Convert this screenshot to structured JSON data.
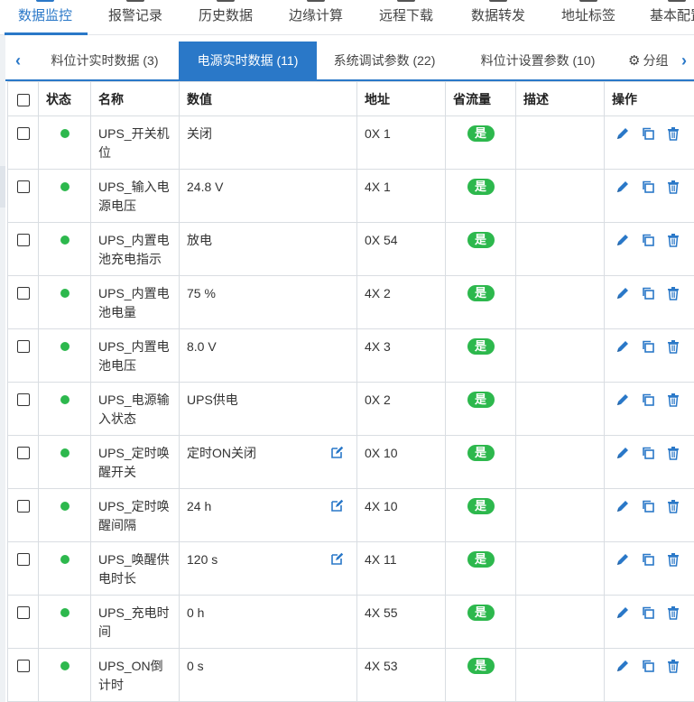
{
  "nav": {
    "items": [
      "数据监控",
      "报警记录",
      "历史数据",
      "边缘计算",
      "远程下载",
      "数据转发",
      "地址标签",
      "基本配置"
    ],
    "active_index": 0
  },
  "tabs": {
    "prev_arrow": "‹",
    "next_arrow": "›",
    "items": [
      "料位计实时数据 (3)",
      "电源实时数据 (11)",
      "系统调试参数 (22)",
      "料位计设置参数 (10)",
      "分组"
    ],
    "active_index": 1
  },
  "table": {
    "headers": {
      "status": "状态",
      "name": "名称",
      "value": "数值",
      "address": "地址",
      "save_flow": "省流量",
      "description": "描述",
      "actions": "操作"
    },
    "rows": [
      {
        "name": "UPS_开关机位",
        "value": "关闭",
        "address": "0X 1",
        "save_flow": "是",
        "editable": false
      },
      {
        "name": "UPS_输入电源电压",
        "value": "24.8 V",
        "address": "4X 1",
        "save_flow": "是",
        "editable": false
      },
      {
        "name": "UPS_内置电池充电指示",
        "value": "放电",
        "address": "0X 54",
        "save_flow": "是",
        "editable": false
      },
      {
        "name": "UPS_内置电池电量",
        "value": "75 %",
        "address": "4X 2",
        "save_flow": "是",
        "editable": false
      },
      {
        "name": "UPS_内置电池电压",
        "value": "8.0 V",
        "address": "4X 3",
        "save_flow": "是",
        "editable": false
      },
      {
        "name": "UPS_电源输入状态",
        "value": "UPS供电",
        "address": "0X 2",
        "save_flow": "是",
        "editable": false
      },
      {
        "name": "UPS_定时唤醒开关",
        "value": "定时ON关闭",
        "address": "0X 10",
        "save_flow": "是",
        "editable": true
      },
      {
        "name": "UPS_定时唤醒间隔",
        "value": "24 h",
        "address": "4X 10",
        "save_flow": "是",
        "editable": true
      },
      {
        "name": "UPS_唤醒供电时长",
        "value": "120 s",
        "address": "4X 11",
        "save_flow": "是",
        "editable": true
      },
      {
        "name": "UPS_充电时间",
        "value": "0 h",
        "address": "4X 55",
        "save_flow": "是",
        "editable": false
      },
      {
        "name": "UPS_ON倒计时",
        "value": "0 s",
        "address": "4X 53",
        "save_flow": "是",
        "editable": false
      }
    ]
  },
  "colors": {
    "accent": "#2a78c8",
    "status_online": "#2db84d",
    "badge_green": "#2db84d"
  }
}
